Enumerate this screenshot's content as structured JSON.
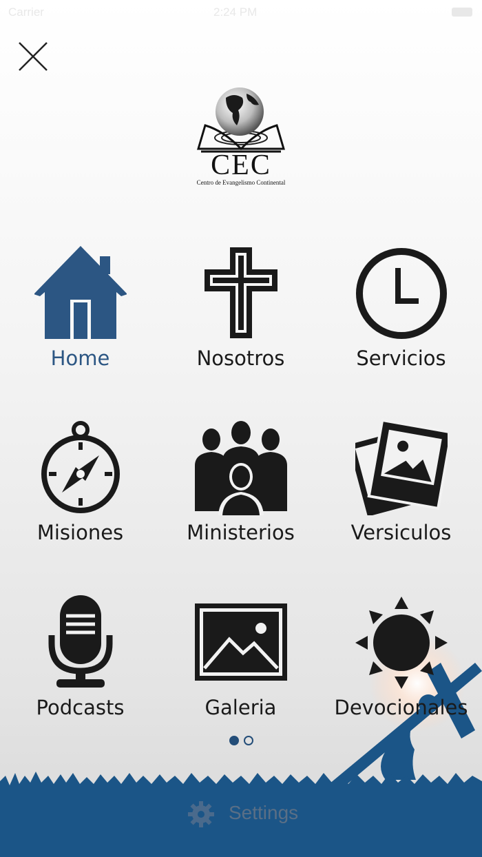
{
  "status_bar": {
    "carrier": "Carrier",
    "time": "2:24 PM"
  },
  "header": {
    "close_icon": "close-icon",
    "logo_text": "CEC",
    "logo_subtitle": "Centro de Evangelismo Continental"
  },
  "menu": [
    {
      "label": "Home",
      "icon": "house-icon",
      "active": true
    },
    {
      "label": "Nosotros",
      "icon": "cross-icon",
      "active": false
    },
    {
      "label": "Servicios",
      "icon": "clock-icon",
      "active": false
    },
    {
      "label": "Misiones",
      "icon": "compass-icon",
      "active": false
    },
    {
      "label": "Ministerios",
      "icon": "people-icon",
      "active": false
    },
    {
      "label": "Versiculos",
      "icon": "photos-icon",
      "active": false
    },
    {
      "label": "Podcasts",
      "icon": "microphone-icon",
      "active": false
    },
    {
      "label": "Galeria",
      "icon": "picture-icon",
      "active": false
    },
    {
      "label": "Devocionales",
      "icon": "sun-icon",
      "active": false
    }
  ],
  "pager": {
    "page": 1,
    "total": 2
  },
  "footer": {
    "settings_label": "Settings",
    "settings_icon": "gear-icon"
  },
  "colors": {
    "accent": "#2c5683",
    "icon": "#1a1a1a",
    "ground": "#1b5587"
  }
}
